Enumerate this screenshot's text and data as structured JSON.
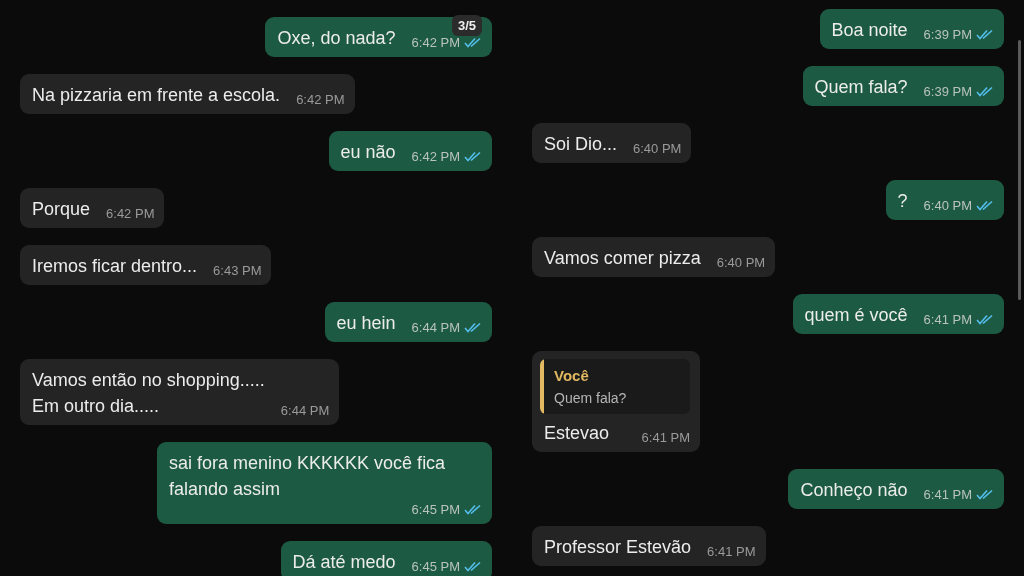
{
  "panels": [
    {
      "badge": "3/5",
      "messages": [
        {
          "kind": "out",
          "text": "Oxe, do nada?",
          "time": "6:42 PM",
          "read": true
        },
        {
          "kind": "in",
          "text": "Na pizzaria em frente a escola.",
          "time": "6:42 PM"
        },
        {
          "kind": "out",
          "text": "eu não",
          "time": "6:42 PM",
          "read": true
        },
        {
          "kind": "in",
          "text": "Porque",
          "time": "6:42 PM"
        },
        {
          "kind": "in",
          "text": "Iremos ficar dentro...",
          "time": "6:43 PM"
        },
        {
          "kind": "out",
          "text": "eu hein",
          "time": "6:44 PM",
          "read": true
        },
        {
          "kind": "in",
          "text": "Vamos então no shopping.....\nEm outro dia.....",
          "time": "6:44 PM"
        },
        {
          "kind": "out",
          "text": "sai fora menino KKKKKK você fica falando assim",
          "time": "6:45 PM",
          "read": true
        },
        {
          "kind": "out",
          "text": "Dá até medo",
          "time": "6:45 PM",
          "read": true
        }
      ]
    },
    {
      "messages": [
        {
          "kind": "out",
          "text": "Boa noite",
          "time": "6:39 PM",
          "read": true
        },
        {
          "kind": "out",
          "text": "Quem fala?",
          "time": "6:39 PM",
          "read": true
        },
        {
          "kind": "in",
          "text": "Soi Dio...",
          "time": "6:40 PM"
        },
        {
          "kind": "out",
          "text": "?",
          "time": "6:40 PM",
          "read": true
        },
        {
          "kind": "in",
          "text": "Vamos comer pizza",
          "time": "6:40 PM"
        },
        {
          "kind": "out",
          "text": "quem é você",
          "time": "6:41 PM",
          "read": true
        },
        {
          "kind": "in",
          "text": "Estevao",
          "time": "6:41 PM",
          "reply": {
            "author": "Você",
            "text": "Quem fala?"
          }
        },
        {
          "kind": "out",
          "text": "Conheço não",
          "time": "6:41 PM",
          "read": true
        },
        {
          "kind": "in",
          "text": "Professor Estevão",
          "time": "6:41 PM"
        }
      ]
    }
  ]
}
